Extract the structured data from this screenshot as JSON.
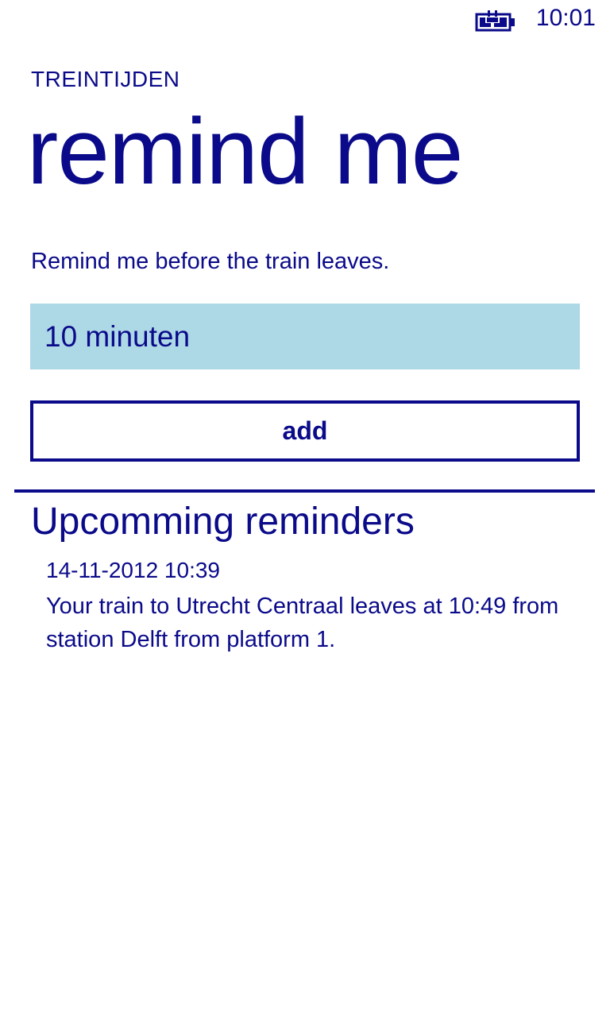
{
  "status_bar": {
    "time": "10:01",
    "battery_icon": "battery-charging-icon"
  },
  "header": {
    "app_title": "TREINTIJDEN",
    "page_title": "remind me"
  },
  "form": {
    "instruction": "Remind me before the train leaves.",
    "selected_interval": "10 minuten",
    "add_label": "add"
  },
  "reminders": {
    "section_title": "Upcomming reminders",
    "items": [
      {
        "datetime": "14-11-2012 10:39",
        "message": "Your train to Utrecht Centraal leaves at 10:49 from station Delft from platform 1."
      }
    ]
  },
  "colors": {
    "accent": "#0a0a8a",
    "picker_background": "#add8e6",
    "background": "#ffffff"
  }
}
